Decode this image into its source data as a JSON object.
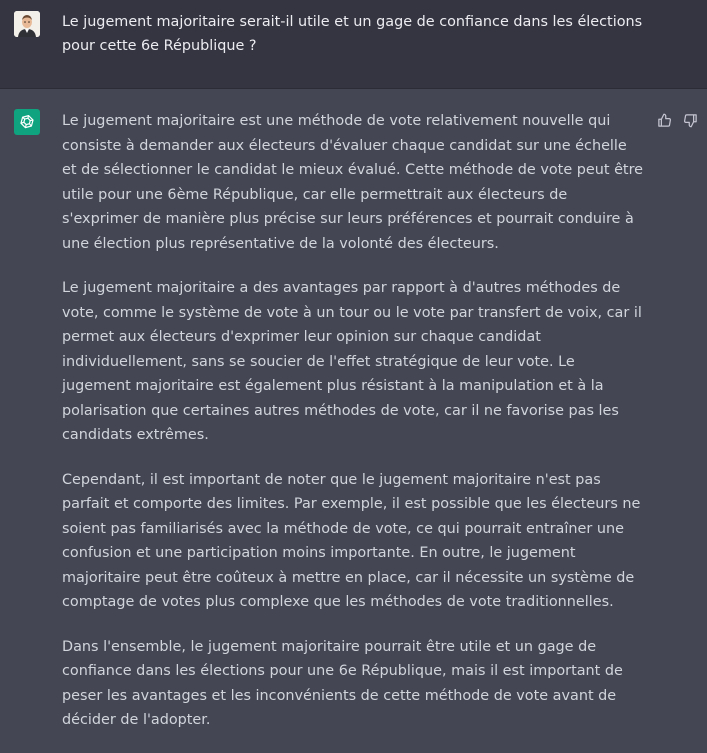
{
  "user_message": "Le jugement majoritaire serait-il utile et un gage de confiance dans les élections pour cette 6e République ?",
  "assistant_message": {
    "paragraphs": [
      "Le jugement majoritaire est une méthode de vote relativement nouvelle qui consiste à demander aux électeurs d'évaluer chaque candidat sur une échelle et de sélectionner le candidat le mieux évalué. Cette méthode de vote peut être utile pour une 6ème République, car elle permettrait aux électeurs de s'exprimer de manière plus précise sur leurs préférences et pourrait conduire à une élection plus représentative de la volonté des électeurs.",
      "Le jugement majoritaire a des avantages par rapport à d'autres méthodes de vote, comme le système de vote à un tour ou le vote par transfert de voix, car il permet aux électeurs d'exprimer leur opinion sur chaque candidat individuellement, sans se soucier de l'effet stratégique de leur vote. Le jugement majoritaire est également plus résistant à la manipulation et à la polarisation que certaines autres méthodes de vote, car il ne favorise pas les candidats extrêmes.",
      "Cependant, il est important de noter que le jugement majoritaire n'est pas parfait et comporte des limites. Par exemple, il est possible que les électeurs ne soient pas familiarisés avec la méthode de vote, ce qui pourrait entraîner une confusion et une participation moins importante. En outre, le jugement majoritaire peut être coûteux à mettre en place, car il nécessite un système de comptage de votes plus complexe que les méthodes de vote traditionnelles.",
      "Dans l'ensemble, le jugement majoritaire pourrait être utile et un gage de confiance dans les élections pour une 6e République, mais il est important de peser les avantages et les inconvénients de cette méthode de vote avant de décider de l'adopter."
    ]
  },
  "icons": {
    "user_avatar": "user-avatar",
    "assistant_avatar": "openai-logo-icon",
    "thumbs_up": "thumbs-up-icon",
    "thumbs_down": "thumbs-down-icon"
  },
  "colors": {
    "user_background": "#343541",
    "assistant_background": "#444654",
    "assistant_avatar_bg": "#10a37f",
    "text": "#d1d5db"
  }
}
